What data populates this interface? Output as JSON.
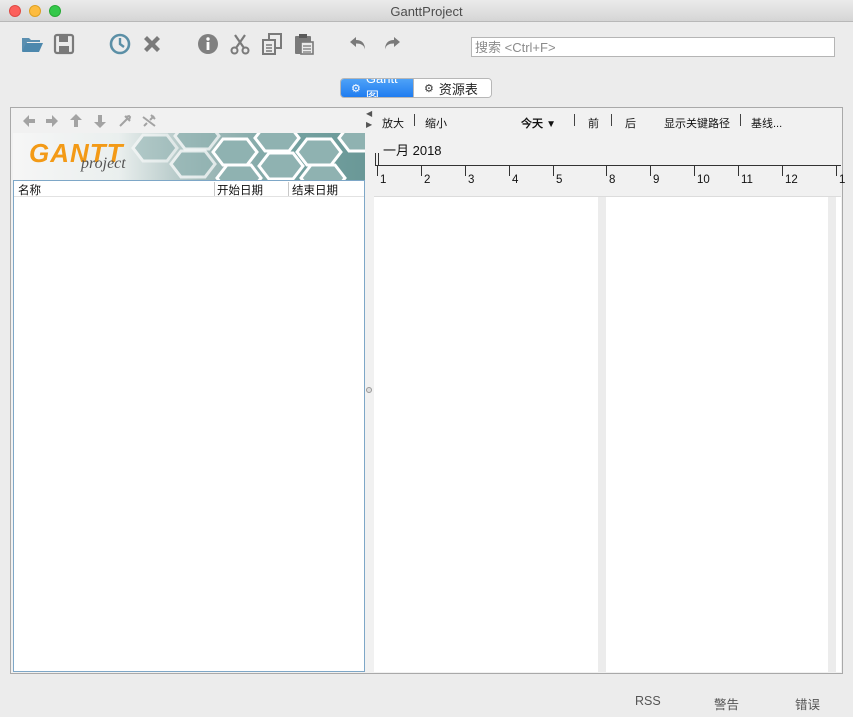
{
  "window": {
    "title": "GanttProject"
  },
  "toolbar": {
    "icons": [
      "open-folder-icon",
      "save-icon",
      "history-icon",
      "delete-icon",
      "info-icon",
      "cut-icon",
      "copy-icon",
      "paste-icon",
      "undo-icon",
      "redo-icon"
    ],
    "search_placeholder": "搜索 <Ctrl+F>"
  },
  "tabs": [
    {
      "label": "Gantt 图",
      "active": true
    },
    {
      "label": "资源表",
      "active": false
    }
  ],
  "left_panel": {
    "tools": [
      "arrow-left-icon",
      "arrow-right-icon",
      "arrow-up-icon",
      "arrow-down-icon",
      "link-icon",
      "unlink-icon"
    ],
    "logo": {
      "main": "GANTT",
      "sub": "project"
    },
    "columns": [
      "名称",
      "开始日期",
      "结束日期"
    ]
  },
  "gantt": {
    "toolbar": {
      "zoom_in": "放大",
      "zoom_out": "缩小",
      "today": "今天",
      "prev": "前",
      "next": "后",
      "critical_path": "显示关键路径",
      "baseline": "基线..."
    },
    "month_label": "一月 2018",
    "days": [
      "1",
      "2",
      "3",
      "4",
      "5",
      "8",
      "9",
      "10",
      "11",
      "12",
      "1"
    ]
  },
  "statusbar": {
    "rss": "RSS",
    "warnings": "警告",
    "errors": "错误"
  },
  "colors": {
    "accent": "#1f7cf0",
    "logo_orange": "#f39a16",
    "teal": "#6a9897"
  }
}
